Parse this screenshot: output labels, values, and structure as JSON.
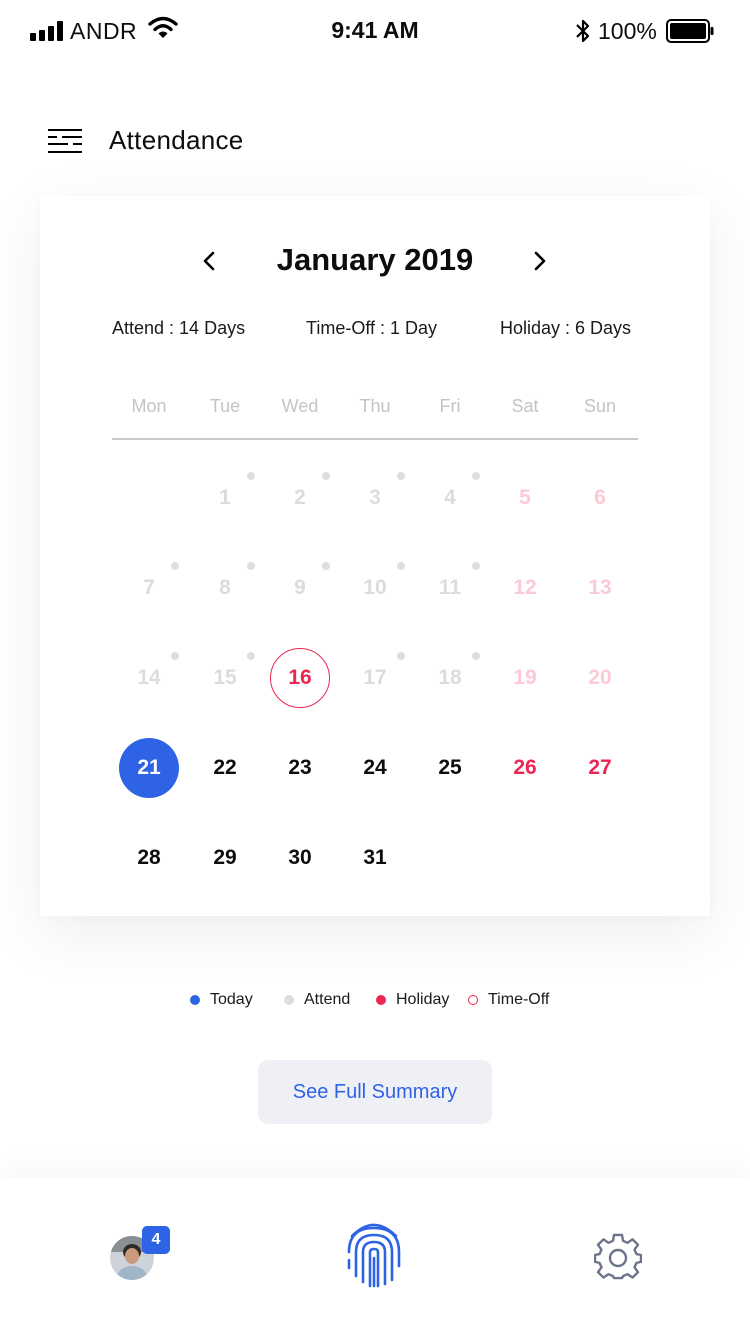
{
  "status_bar": {
    "carrier": "ANDR",
    "time": "9:41 AM",
    "battery": "100%"
  },
  "header": {
    "title": "Attendance",
    "menu_icon": "menu-icon"
  },
  "calendar": {
    "month": "January 2019",
    "prev_icon": "chevron-left-icon",
    "next_icon": "chevron-right-icon",
    "stats": {
      "attend": "Attend : 14 Days",
      "timeoff": "Time-Off : 1 Day",
      "holiday": "Holiday : 6 Days"
    },
    "weekdays": [
      "Mon",
      "Tue",
      "Wed",
      "Thu",
      "Fri",
      "Sat",
      "Sun"
    ],
    "weeks": [
      [
        null,
        {
          "d": "1",
          "s": "past",
          "dot": true
        },
        {
          "d": "2",
          "s": "past",
          "dot": true
        },
        {
          "d": "3",
          "s": "past",
          "dot": true
        },
        {
          "d": "4",
          "s": "past",
          "dot": true
        },
        {
          "d": "5",
          "s": "past-weekend"
        },
        {
          "d": "6",
          "s": "past-weekend"
        }
      ],
      [
        {
          "d": "7",
          "s": "past",
          "dot": true
        },
        {
          "d": "8",
          "s": "past",
          "dot": true
        },
        {
          "d": "9",
          "s": "past",
          "dot": true
        },
        {
          "d": "10",
          "s": "past",
          "dot": true
        },
        {
          "d": "11",
          "s": "past",
          "dot": true
        },
        {
          "d": "12",
          "s": "past-weekend"
        },
        {
          "d": "13",
          "s": "past-weekend"
        }
      ],
      [
        {
          "d": "14",
          "s": "past",
          "dot": true
        },
        {
          "d": "15",
          "s": "past",
          "dot": true
        },
        {
          "d": "16",
          "s": "timeoff"
        },
        {
          "d": "17",
          "s": "past",
          "dot": true
        },
        {
          "d": "18",
          "s": "past",
          "dot": true
        },
        {
          "d": "19",
          "s": "past-weekend"
        },
        {
          "d": "20",
          "s": "past-weekend"
        }
      ],
      [
        {
          "d": "21",
          "s": "today"
        },
        {
          "d": "22",
          "s": "current"
        },
        {
          "d": "23",
          "s": "current"
        },
        {
          "d": "24",
          "s": "current"
        },
        {
          "d": "25",
          "s": "current"
        },
        {
          "d": "26",
          "s": "current-weekend"
        },
        {
          "d": "27",
          "s": "current-weekend"
        }
      ],
      [
        {
          "d": "28",
          "s": "current"
        },
        {
          "d": "29",
          "s": "current"
        },
        {
          "d": "30",
          "s": "current"
        },
        {
          "d": "31",
          "s": "current"
        },
        null,
        null,
        null
      ]
    ]
  },
  "legend": [
    {
      "label": "Today",
      "color": "#2e63e6",
      "style": "filled"
    },
    {
      "label": "Attend",
      "color": "#dededf",
      "style": "filled"
    },
    {
      "label": "Holiday",
      "color": "#ec2850",
      "style": "filled"
    },
    {
      "label": "Time-Off",
      "color": "#ec2850",
      "style": "outline"
    }
  ],
  "summary_button": "See Full Summary",
  "tab_bar": {
    "badge_count": "4",
    "center_icon": "fingerprint-icon",
    "settings_icon": "gear-icon"
  },
  "colors": {
    "accent": "#2e63e6",
    "holiday": "#ec2850",
    "attend": "#dededf"
  }
}
